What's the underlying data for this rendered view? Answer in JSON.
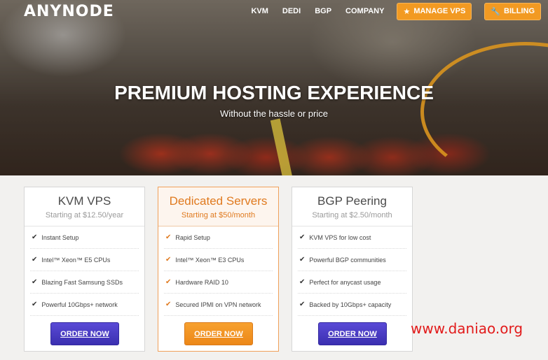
{
  "brand": {
    "logo": "ANYNODE"
  },
  "nav": {
    "links": [
      "KVM",
      "DEDI",
      "BGP",
      "COMPANY"
    ],
    "manage_vps": "MANAGE VPS",
    "billing": "BILLING"
  },
  "hero": {
    "title": "PREMIUM HOSTING EXPERIENCE",
    "subtitle": "Without the hassle or price"
  },
  "plans": [
    {
      "title": "KVM VPS",
      "price": "Starting at $12.50/year",
      "features": [
        "Instant Setup",
        "Intel™ Xeon™ E5 CPUs",
        "Blazing Fast Samsung SSDs",
        "Powerful 10Gbps+ network"
      ],
      "cta": "ORDER NOW"
    },
    {
      "title": "Dedicated Servers",
      "price": "Starting at $50/month",
      "features": [
        "Rapid Setup",
        "Intel™ Xeon™ E3 CPUs",
        "Hardware RAID 10",
        "Secured IPMI on VPN network"
      ],
      "cta": "ORDER NOW"
    },
    {
      "title": "BGP Peering",
      "price": "Starting at $2.50/month",
      "features": [
        "KVM VPS for low cost",
        "Powerful BGP communities",
        "Perfect for anycast usage",
        "Backed by 10Gbps+ capacity"
      ],
      "cta": "ORDER NOW"
    }
  ],
  "watermark": "www.daniao.org",
  "colors": {
    "accent_orange": "#f29a22",
    "button_purple": "#3b2fb0",
    "watermark_red": "#e21b1b"
  },
  "icons": {
    "manage_vps": "star-icon",
    "billing": "wrench-icon",
    "feature": "check-icon"
  }
}
